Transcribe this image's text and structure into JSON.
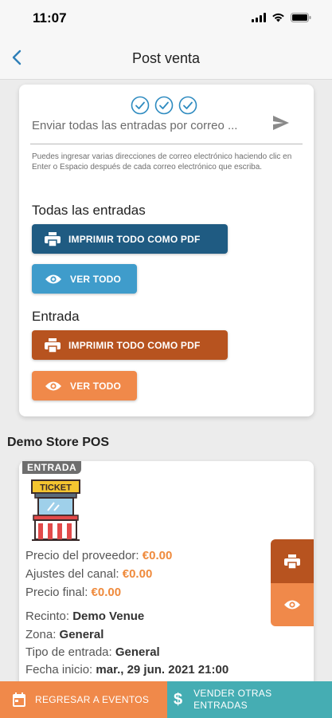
{
  "status": {
    "time": "11:07"
  },
  "nav": {
    "title": "Post venta"
  },
  "email": {
    "placeholder": "Enviar todas las entradas por correo ...",
    "hint": "Puedes ingresar varias direcciones de correo electrónico haciendo clic en Enter o Espacio después de cada correo electrónico que escriba."
  },
  "all_tickets": {
    "title": "Todas las entradas",
    "print_label": "IMPRIMIR TODO COMO PDF",
    "view_label": "VER TODO"
  },
  "entry": {
    "title": "Entrada",
    "print_label": "IMPRIMIR TODO COMO PDF",
    "view_label": "VER TODO"
  },
  "store": {
    "name": "Demo Store POS"
  },
  "ticket": {
    "badge": "ENTRADA",
    "image_text": "TICKET",
    "provider_price_label": "Precio del proveedor:",
    "provider_price": "€0.00",
    "channel_adjust_label": "Ajustes del canal:",
    "channel_adjust": "€0.00",
    "final_price_label": "Precio final:",
    "final_price": "€0.00",
    "venue_label": "Recinto:",
    "venue": "Demo Venue",
    "zone_label": "Zona:",
    "zone": "General",
    "type_label": "Tipo de entrada:",
    "type": "General",
    "start_label": "Fecha inicio:",
    "start": "mar., 29 jun. 2021 21:00"
  },
  "bottom": {
    "back_label": "REGRESAR A EVENTOS",
    "sell_label_1": "VENDER OTRAS",
    "sell_label_2": "ENTRADAS"
  },
  "colors": {
    "navy": "#1f5b82",
    "light_blue": "#3f9ccb",
    "rust": "#b7531f",
    "orange": "#f0894a",
    "teal": "#45adb3"
  }
}
